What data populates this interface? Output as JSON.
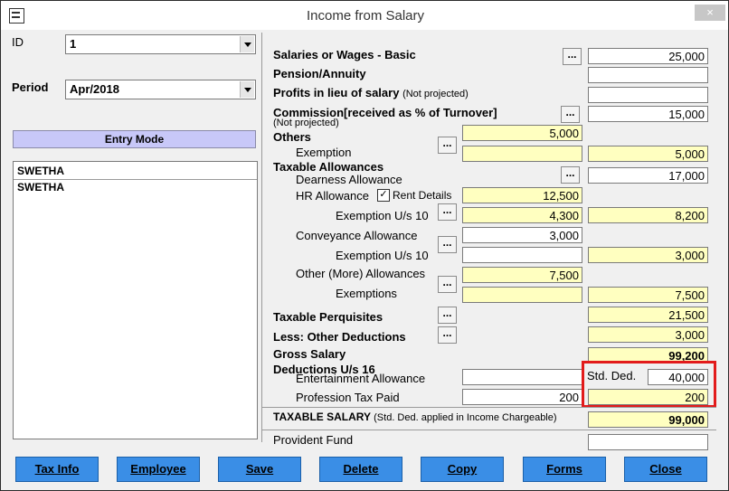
{
  "window": {
    "title": "Income from Salary",
    "close_label": "×"
  },
  "left": {
    "id_label": "ID",
    "id_value": "1",
    "period_label": "Period",
    "period_value": "Apr/2018",
    "entry_mode": "Entry Mode",
    "list": [
      "SWETHA",
      "SWETHA"
    ]
  },
  "form": {
    "salaries_basic": {
      "label": "Salaries or Wages - Basic",
      "value": "25,000"
    },
    "pension": {
      "label": "Pension/Annuity",
      "value": ""
    },
    "profits": {
      "label": "Profits in lieu of salary",
      "note": "(Not projected)",
      "value": ""
    },
    "commission": {
      "label": "Commission[received as % of Turnover]",
      "note": "(Not projected)",
      "value": "15,000"
    },
    "others": {
      "label": "Others",
      "value": "5,000"
    },
    "exemption": {
      "label": "Exemption",
      "value": "5,000"
    },
    "taxable_allowances": {
      "label": "Taxable Allowances"
    },
    "dearness": {
      "label": "Dearness Allowance",
      "value": "17,000"
    },
    "hra": {
      "label": "HR Allowance",
      "rent_label": "Rent Details",
      "rent_checked": true,
      "value": "12,500"
    },
    "hra_exemption": {
      "label": "Exemption U/s 10",
      "value1": "4,300",
      "value2": "8,200"
    },
    "conveyance": {
      "label": "Conveyance Allowance",
      "value": "3,000"
    },
    "conv_exemption": {
      "label": "Exemption U/s 10",
      "value1": "",
      "value2": "3,000"
    },
    "other_more": {
      "label": "Other (More) Allowances",
      "value": "7,500"
    },
    "exemptions": {
      "label": "Exemptions",
      "value1": "",
      "value2": "7,500"
    },
    "perquisites": {
      "label": "Taxable Perquisites",
      "value": "21,500"
    },
    "other_deductions": {
      "label": "Less: Other Deductions",
      "value": "3,000"
    },
    "gross_salary": {
      "label": "Gross Salary",
      "value": "99,200"
    },
    "deductions_header": {
      "label": "Deductions U/s 16"
    },
    "entertainment": {
      "label": "Entertainment Allowance",
      "value": ""
    },
    "std_ded": {
      "label": "Std. Ded.",
      "value": "40,000"
    },
    "profession_tax": {
      "label": "Profession Tax Paid",
      "value1": "200",
      "value2": "200"
    },
    "taxable_salary": {
      "label": "TAXABLE SALARY",
      "note": "(Std. Ded. applied in Income Chargeable)",
      "value": "99,000"
    },
    "provident_fund": {
      "label": "Provident Fund",
      "value": ""
    },
    "dots_label": "..."
  },
  "buttons": [
    "Tax Info",
    "Employee",
    "Save",
    "Delete",
    "Copy",
    "Forms",
    "Close"
  ],
  "colors": {
    "button_bg": "#3a8ee6",
    "yellow_field": "#ffffc0",
    "entry_mode_bg": "#c8c8f8",
    "highlight": "#e21b1b"
  }
}
